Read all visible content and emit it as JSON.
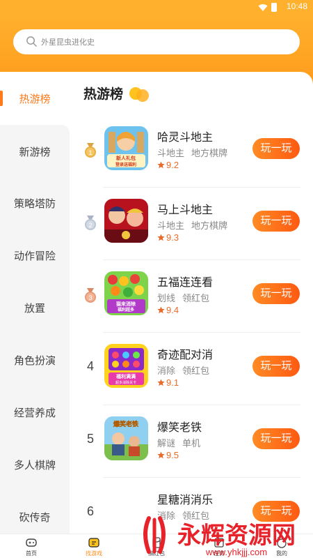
{
  "status_bar": {
    "time": "10:48",
    "wifi_icon": "wifi-icon",
    "battery_icon": "battery-icon"
  },
  "search": {
    "placeholder": "外星昆虫进化史",
    "icon": "search-icon"
  },
  "sidebar": {
    "items": [
      {
        "label": "热游榜",
        "active": true
      },
      {
        "label": "新游榜"
      },
      {
        "label": "策略塔防"
      },
      {
        "label": "动作冒险"
      },
      {
        "label": "放置"
      },
      {
        "label": "角色扮演"
      },
      {
        "label": "经营养成"
      },
      {
        "label": "多人棋牌"
      },
      {
        "label": "砍传奇"
      }
    ]
  },
  "main": {
    "title": "热游榜",
    "play_label": "玩一玩",
    "games": [
      {
        "rank": "1",
        "medal": "gold",
        "name": "哈灵斗地主",
        "tags": [
          "斗地主",
          "地方棋牌"
        ],
        "rating": "9.2"
      },
      {
        "rank": "2",
        "medal": "silver",
        "name": "马上斗地主",
        "tags": [
          "斗地主",
          "地方棋牌"
        ],
        "rating": "9.3"
      },
      {
        "rank": "3",
        "medal": "bronze",
        "name": "五福连连看",
        "tags": [
          "划线",
          "领红包"
        ],
        "rating": "9.4"
      },
      {
        "rank": "4",
        "name": "奇迹配对消",
        "tags": [
          "消除",
          "领红包"
        ],
        "rating": "9.1"
      },
      {
        "rank": "5",
        "name": "爆笑老铁",
        "tags": [
          "解谜",
          "单机"
        ],
        "rating": "9.5"
      },
      {
        "rank": "6",
        "name": "星糖消消乐",
        "tags": [
          "消除",
          "领红包"
        ],
        "rating": ""
      }
    ],
    "icon_texts": {
      "game1": [
        "新人礼包",
        "登录送福利"
      ],
      "game3": [
        "猫来消除",
        "福利超多"
      ],
      "game4": [
        "福利满满",
        "超多消除关卡"
      ],
      "game5": [
        "爆笑老铁"
      ]
    }
  },
  "tab_bar": {
    "tabs": [
      {
        "label": "首页",
        "icon": "gamepad-icon"
      },
      {
        "label": "找游戏",
        "icon": "find-game-icon",
        "active": true
      },
      {
        "label": "抽红包",
        "icon": "red-packet-icon"
      },
      {
        "label": "任务",
        "icon": "task-icon"
      },
      {
        "label": "我的",
        "icon": "profile-icon"
      }
    ]
  },
  "watermark": {
    "brand": "永辉资源网",
    "url": "www.yhkjjj.com"
  },
  "colors": {
    "accent": "#ff7a1a",
    "header": "#ffb12e",
    "button": "#ff6a18",
    "rating": "#e86b2a"
  }
}
